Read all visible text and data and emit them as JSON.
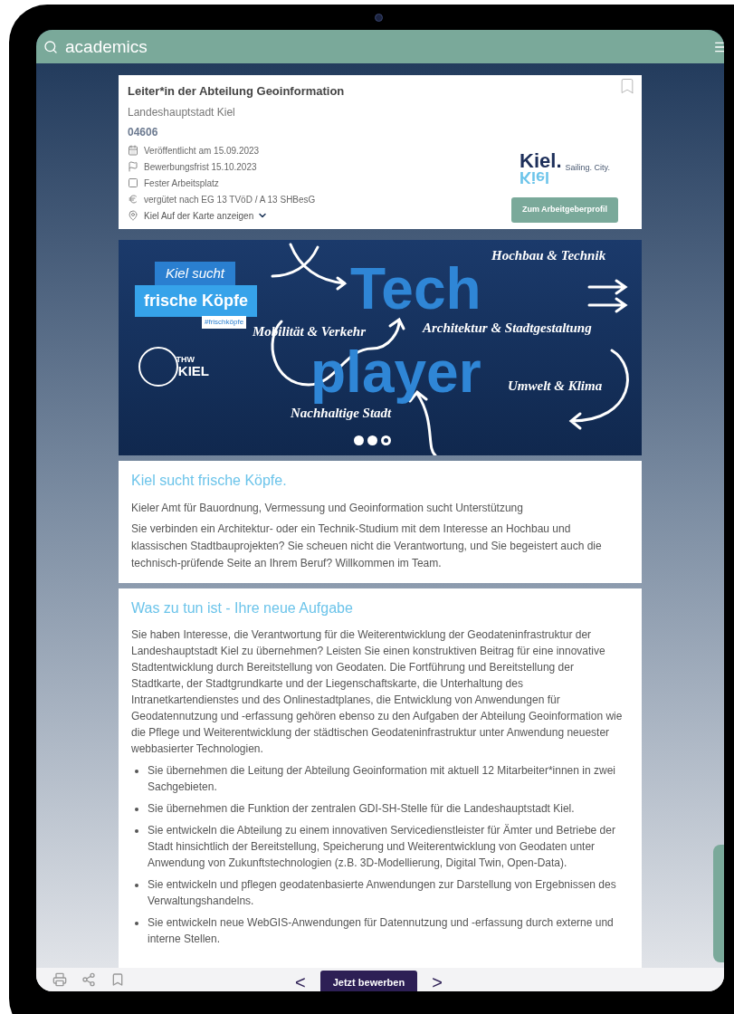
{
  "header": {
    "logo": "academics"
  },
  "job": {
    "title": "Leiter*in der Abteilung Geoinformation",
    "employer": "Landeshauptstadt Kiel",
    "id": "04606",
    "facts": [
      {
        "kind": "calendar",
        "text": "Veröffentlicht am 15.09.2023"
      },
      {
        "kind": "flag",
        "text": "Bewerbungsfrist 15.10.2023"
      },
      {
        "kind": "square",
        "text": "Fester Arbeitsplatz"
      },
      {
        "kind": "euro",
        "text": "vergütet nach EG 13 TVöD / A 13 SHBesG"
      },
      {
        "kind": "pin",
        "text": "Kiel Auf der Karte anzeigen"
      }
    ],
    "logo": {
      "word": "Kiel.",
      "mirror": "Kiel",
      "tagline": "Sailing. City."
    },
    "profile_button": "Zum Arbeitgeberprofil"
  },
  "banner": {
    "badge_top": "Kiel sucht",
    "badge_main": "frische Köpfe",
    "hashtag": "#frischköpfe",
    "club": "THW",
    "club_city": "KIEL",
    "headline": [
      "Tech",
      "player"
    ],
    "topics": [
      "Hochbau & Technik",
      "Mobilität & Verkehr",
      "Architektur & Stadtgestaltung",
      "Nachhaltige Stadt",
      "Umwelt & Klima"
    ],
    "dots": [
      {
        "selected": false
      },
      {
        "selected": false
      },
      {
        "selected": true
      }
    ]
  },
  "intro": {
    "heading": "Kiel sucht frische Köpfe.",
    "lead": "Kieler Amt für Bauordnung, Vermessung und Geoinformation sucht Unterstützung",
    "text": "Sie verbinden ein Architektur- oder ein Technik-Studium mit dem Interesse an Hochbau und klassischen Stadtbauprojekten? Sie scheuen nicht die Verantwortung, und Sie begeistert auch die technisch-prüfende Seite an Ihrem Beruf? Willkommen im Team."
  },
  "tasks": {
    "heading": "Was zu tun ist - Ihre neue Aufgabe",
    "text": "Sie haben Interesse, die Verantwortung für die Weiterentwicklung der Geodateninfrastruktur der Landeshauptstadt Kiel zu übernehmen? Leisten Sie einen konstruktiven Beitrag für eine innovative Stadtentwicklung durch Bereitstellung von Geodaten. Die Fortführung und Bereitstellung der Stadtkarte, der Stadtgrundkarte und der Liegenschaftskarte, die Unterhaltung des Intranetkartendienstes und des Onlinestadtplanes, die Entwicklung von Anwendungen für Geodatennutzung und -erfassung gehören ebenso zu den Aufgaben der Abteilung Geoinformation wie die Pflege und Weiterentwicklung der städtischen Geodateninfrastruktur unter Anwendung neuester webbasierter Technologien.",
    "bullets": [
      "Sie übernehmen die Leitung der Abteilung Geoinformation mit aktuell 12 Mitarbeiter*innen in zwei Sachgebieten.",
      "Sie übernehmen die Funktion der zentralen GDI-SH-Stelle für die Landeshauptstadt Kiel.",
      "Sie entwickeln die Abteilung zu einem innovativen Servicedienstleister für Ämter und Betriebe der Stadt hinsichtlich der Bereitstellung, Speicherung und Weiterentwicklung von Geodaten unter Anwendung von Zukunftstechnologien (z.B. 3D-Modellierung, Digital Twin, Open-Data).",
      "Sie entwickeln und pflegen geodatenbasierte Anwendungen zur Darstellung von Ergebnissen des Verwaltungshandelns.",
      "Sie entwickeln neue WebGIS-Anwendungen für Datennutzung und -erfassung durch externe und interne Stellen."
    ]
  },
  "bottom_bar": {
    "prev": "<",
    "apply": "Jetzt bewerben",
    "next": ">"
  }
}
